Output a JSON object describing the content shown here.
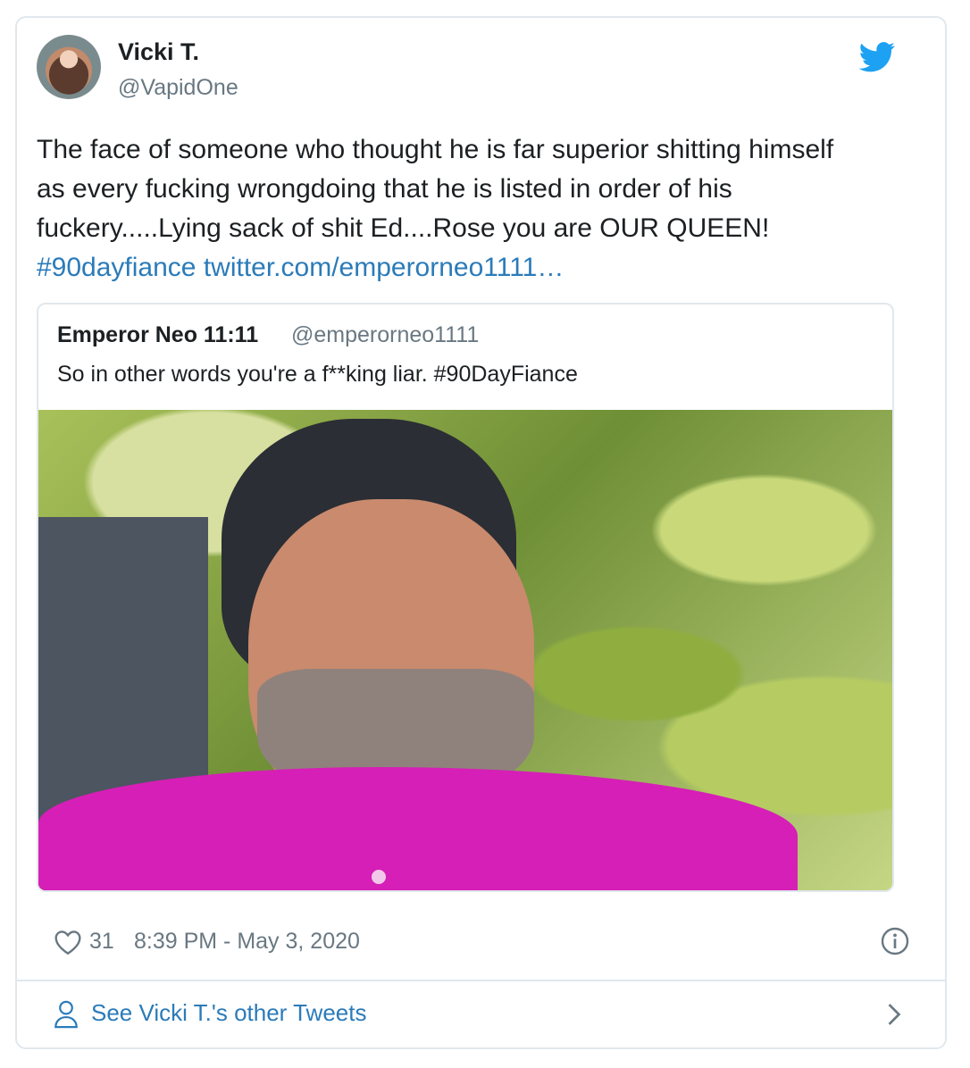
{
  "author": {
    "name": "Vicki T.",
    "handle": "@VapidOne"
  },
  "tweet": {
    "lines": [
      "The face of someone who thought he is far superior shitting himself",
      "as every fucking wrongdoing that he is listed in order of his",
      "fuckery.....Lying sack of shit Ed....Rose you are OUR QUEEN!"
    ],
    "hashtag": "#90dayfiance",
    "url": "twitter.com/emperorneo1111…"
  },
  "quote": {
    "name": "Emperor Neo 11:11",
    "handle": "@emperorneo1111",
    "text": "So in other words you're a f**king liar. #90DayFiance"
  },
  "meta": {
    "likes": "31",
    "timestamp": "8:39 PM - May 3, 2020"
  },
  "footer": {
    "see_other_label": "See Vicki T.'s other Tweets"
  },
  "icons": {
    "brand": "twitter-bird-icon",
    "like": "heart-icon",
    "info": "info-icon",
    "profile": "person-icon",
    "next": "chevron-right-icon"
  },
  "colors": {
    "brand": "#1da1f2",
    "link": "#2b7bb9",
    "muted": "#697882",
    "border": "#e1e8ed"
  }
}
